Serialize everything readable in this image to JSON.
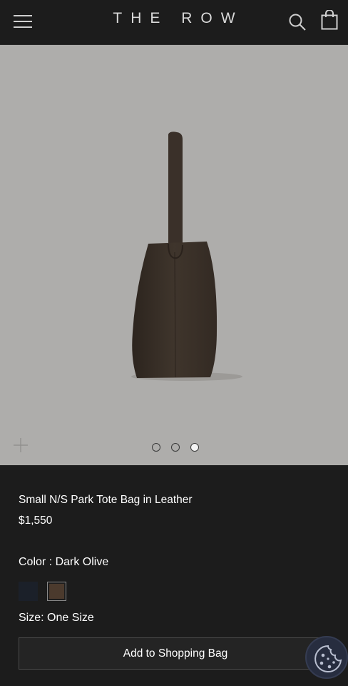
{
  "header": {
    "brand": "THE ROW",
    "icons": [
      "menu-icon",
      "search-icon",
      "shopping-bag-icon"
    ]
  },
  "gallery": {
    "slide_count": 3,
    "active_slide": 3,
    "zoom_icon": "plus-icon"
  },
  "product": {
    "title": "Small N/S Park Tote Bag in Leather",
    "price": "$1,550",
    "color_label": "Color : Dark Olive",
    "swatches": [
      {
        "name": "navy",
        "color": "#1b2029",
        "selected": false
      },
      {
        "name": "dark-olive",
        "color": "#4b3a2d",
        "selected": true
      }
    ],
    "size_label": "Size: One Size",
    "add_button_label": "Add to Shopping Bag"
  },
  "cookie_button": {
    "icon": "cookie-icon"
  },
  "colors": {
    "header_bg": "#1c1c1c",
    "image_bg": "#aeadab",
    "info_bg": "#1c1c1c",
    "bag_leather": "#3d332a"
  }
}
